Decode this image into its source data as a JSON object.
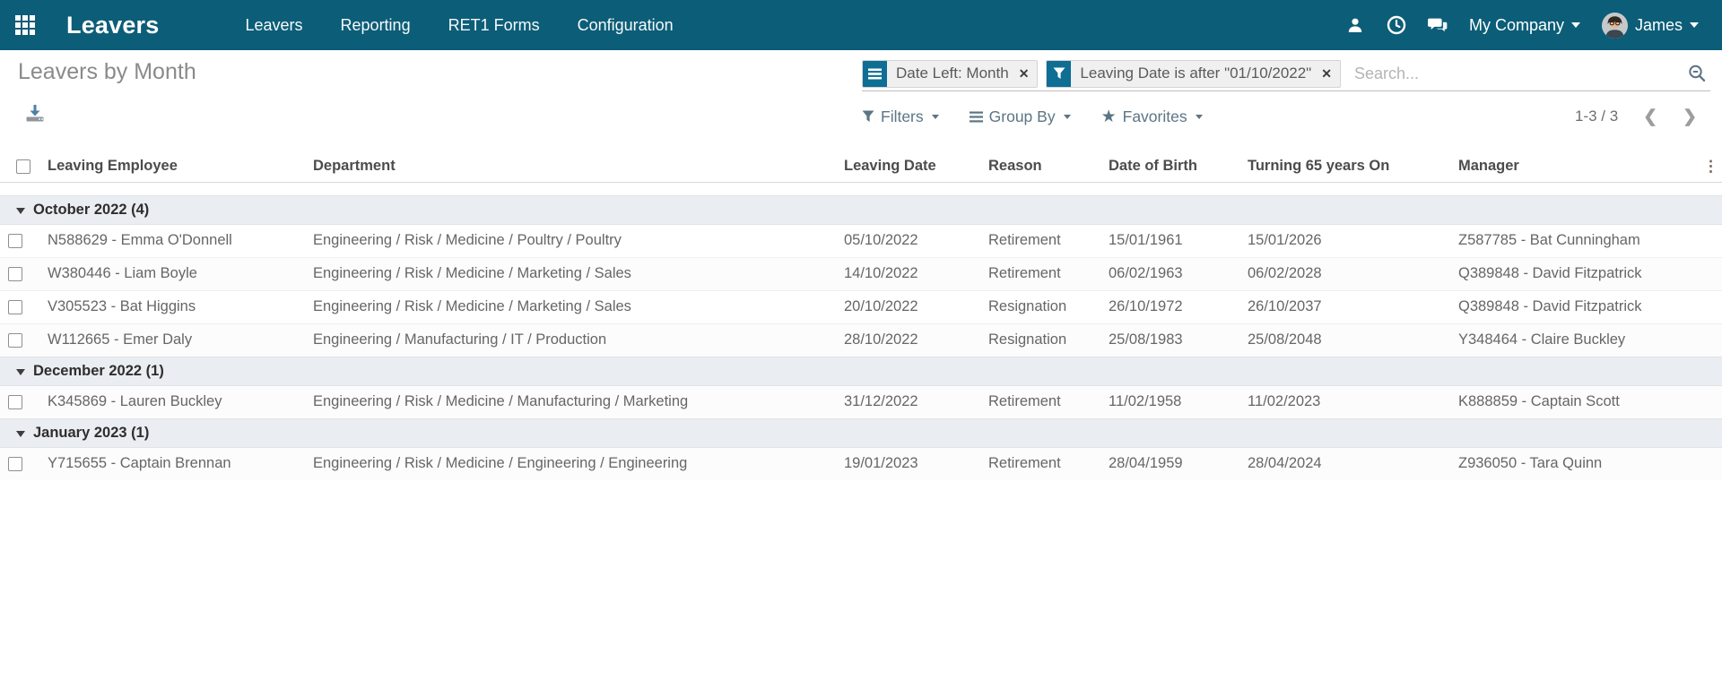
{
  "colors": {
    "brand": "#0c5d78",
    "facet_accent": "#0e6e94",
    "control_icon": "#5c7585"
  },
  "navbar": {
    "brand": "Leavers",
    "menus": [
      {
        "label": "Leavers"
      },
      {
        "label": "Reporting"
      },
      {
        "label": "RET1 Forms"
      },
      {
        "label": "Configuration"
      }
    ],
    "company": "My Company",
    "user": "James"
  },
  "breadcrumb": {
    "title": "Leavers by Month"
  },
  "search": {
    "facets": [
      {
        "icon": "group-by-icon",
        "label": "Date Left: Month"
      },
      {
        "icon": "filter-icon",
        "label": "Leaving Date is after \"01/10/2022\""
      }
    ],
    "placeholder": "Search...",
    "remove_symbol": "✕"
  },
  "controls": {
    "filters_label": "Filters",
    "group_by_label": "Group By",
    "favorites_label": "Favorites",
    "pager_text": "1-3 / 3",
    "prev_symbol": "❮",
    "next_symbol": "❯",
    "options_symbol": "⋮"
  },
  "table": {
    "columns": [
      "Leaving Employee",
      "Department",
      "Leaving Date",
      "Reason",
      "Date of Birth",
      "Turning 65 years On",
      "Manager"
    ],
    "groups": [
      {
        "label": "October 2022 (4)",
        "rows": [
          {
            "employee": "N588629 - Emma O'Donnell",
            "department": "Engineering / Risk / Medicine / Poultry / Poultry",
            "leaving_date": "05/10/2022",
            "reason": "Retirement",
            "dob": "15/01/1961",
            "turning_65": "15/01/2026",
            "manager": "Z587785 - Bat Cunningham"
          },
          {
            "employee": "W380446 - Liam Boyle",
            "department": "Engineering / Risk / Medicine / Marketing / Sales",
            "leaving_date": "14/10/2022",
            "reason": "Retirement",
            "dob": "06/02/1963",
            "turning_65": "06/02/2028",
            "manager": "Q389848 - David Fitzpatrick"
          },
          {
            "employee": "V305523 - Bat Higgins",
            "department": "Engineering / Risk / Medicine / Marketing / Sales",
            "leaving_date": "20/10/2022",
            "reason": "Resignation",
            "dob": "26/10/1972",
            "turning_65": "26/10/2037",
            "manager": "Q389848 - David Fitzpatrick"
          },
          {
            "employee": "W112665 - Emer Daly",
            "department": "Engineering / Manufacturing / IT / Production",
            "leaving_date": "28/10/2022",
            "reason": "Resignation",
            "dob": "25/08/1983",
            "turning_65": "25/08/2048",
            "manager": "Y348464 - Claire Buckley"
          }
        ]
      },
      {
        "label": "December 2022 (1)",
        "rows": [
          {
            "employee": "K345869 - Lauren Buckley",
            "department": "Engineering / Risk / Medicine / Manufacturing / Marketing",
            "leaving_date": "31/12/2022",
            "reason": "Retirement",
            "dob": "11/02/1958",
            "turning_65": "11/02/2023",
            "manager": "K888859 - Captain Scott"
          }
        ]
      },
      {
        "label": "January 2023 (1)",
        "rows": [
          {
            "employee": "Y715655 - Captain Brennan",
            "department": "Engineering / Risk / Medicine / Engineering / Engineering",
            "leaving_date": "19/01/2023",
            "reason": "Retirement",
            "dob": "28/04/1959",
            "turning_65": "28/04/2024",
            "manager": "Z936050 - Tara Quinn"
          }
        ]
      }
    ]
  }
}
